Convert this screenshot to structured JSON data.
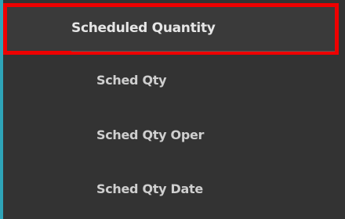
{
  "menu": {
    "header": {
      "label": "Scheduled Quantity"
    },
    "items": [
      {
        "label": "Sched Qty"
      },
      {
        "label": "Sched Qty Oper"
      },
      {
        "label": "Sched Qty Date"
      }
    ]
  },
  "colors": {
    "panel_background": "#333333",
    "highlight_border": "#ee0000",
    "accent_edge": "#2ea4b8",
    "header_text": "#e6e6e6",
    "item_text": "#cfcfcf"
  }
}
